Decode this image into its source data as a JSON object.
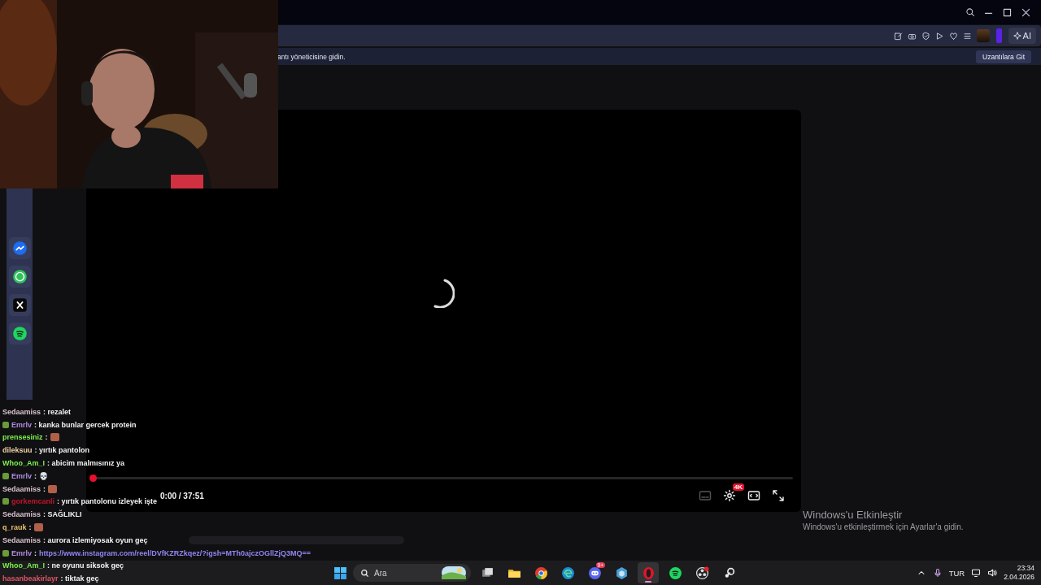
{
  "notice": {
    "text": "antı yöneticisine gidin.",
    "button": "Uzantılara Git"
  },
  "toolbar": {
    "ai_button": "AI"
  },
  "sidebar": {
    "apps": [
      {
        "kind": "messenger"
      },
      {
        "kind": "whatsapp"
      },
      {
        "kind": "x"
      },
      {
        "kind": "spotify"
      }
    ]
  },
  "video": {
    "progress": {
      "level": 0
    },
    "time": "0:00 / 37:51",
    "quality_badge": "4K"
  },
  "chat": [
    {
      "user": "Sedaamiss",
      "color": "#d9c3cc",
      "badge": false,
      "text": ": rezalet"
    },
    {
      "user": "Emrlv",
      "color": "#b08ce0",
      "badge": true,
      "text": ": kanka bunlar gercek protein"
    },
    {
      "user": "prensesiniz",
      "color": "#7cf04c",
      "badge": false,
      "text": ":",
      "emote": true
    },
    {
      "user": "dileksuu",
      "color": "#f0d2a8",
      "badge": false,
      "text": ": yırtık pantolon"
    },
    {
      "user": "Whoo_Am_I",
      "color": "#7cf04c",
      "badge": false,
      "text": ": abicim malmısınız ya"
    },
    {
      "user": "Emrlv",
      "color": "#b08ce0",
      "badge": true,
      "text": ": 💀"
    },
    {
      "user": "Sedaamiss",
      "color": "#d9c3cc",
      "badge": false,
      "text": ":",
      "emote": true
    },
    {
      "user": "gorkemcanli",
      "color": "#c0142c",
      "badge": true,
      "text": ": yırtık pantolonu izleyek işte"
    },
    {
      "user": "Sedaamiss",
      "color": "#d9c3cc",
      "badge": false,
      "text": ": SAĞLIKLI"
    },
    {
      "user": "q_rauk",
      "color": "#e8c070",
      "badge": false,
      "text": ":",
      "emote": true
    },
    {
      "user": "Sedaamiss",
      "color": "#d9c3cc",
      "badge": false,
      "text": ": aurora izlemiyosak oyun geç"
    },
    {
      "user": "Emrlv",
      "color": "#b08ce0",
      "badge": true,
      "text": ":",
      "link": "https://www.instagram.com/reel/DVfKZRZkqez/?igsh=MTh0ajczOGllZjQ3MQ=="
    },
    {
      "user": "Whoo_Am_I",
      "color": "#7cf04c",
      "badge": false,
      "text": ": ne oyunu siksok geç"
    },
    {
      "user": "hasanbeakirlayr",
      "color": "#e05565",
      "badge": false,
      "text": ": tiktak geç"
    }
  ],
  "activation": {
    "title": "Windows'u Etkinleştir",
    "text": "Windows'u etkinleştirmek için Ayarlar'a gidin."
  },
  "taskbar": {
    "search_placeholder": "Ara",
    "apps": [
      {
        "kind": "taskview",
        "selected": false
      },
      {
        "kind": "files",
        "selected": false
      },
      {
        "kind": "chrome",
        "selected": false
      },
      {
        "kind": "edge",
        "selected": false
      },
      {
        "kind": "discord",
        "selected": false,
        "badge": "9+"
      },
      {
        "kind": "tool",
        "selected": false
      },
      {
        "kind": "opera",
        "selected": true
      },
      {
        "kind": "spotify",
        "selected": false
      },
      {
        "kind": "obs",
        "selected": false
      },
      {
        "kind": "steam",
        "selected": false
      }
    ],
    "language": "TUR",
    "time": "23:34",
    "date": "2.04.2026"
  }
}
